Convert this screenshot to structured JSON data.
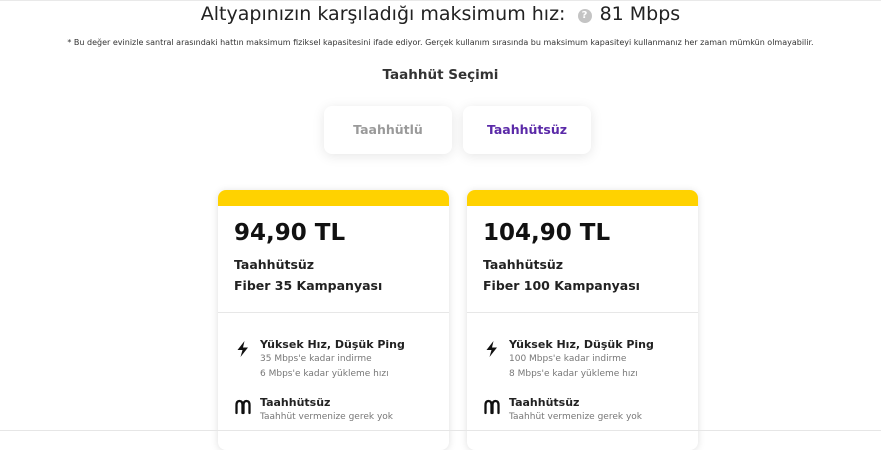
{
  "header": {
    "speed_label": "Altyapınızın karşıladığı maksimum hız:",
    "speed_value": "81 Mbps",
    "help_icon": "question-circle-icon"
  },
  "note": "* Bu değer evinizle santral arasındaki hattın maksimum fiziksel kapasitesini ifade ediyor. Gerçek kullanım sırasında bu maksimum kapasiteyi kullanmanız her zaman mümkün olmayabilir.",
  "commitment": {
    "title": "Taahhüt Seçimi",
    "options": [
      {
        "label": "Taahhütlü",
        "selected": false
      },
      {
        "label": "Taahhütsüz",
        "selected": true
      }
    ],
    "selected_color": "#5b2aa8"
  },
  "accent_color": "#ffd200",
  "plans": [
    {
      "price": "94,90 TL",
      "type": "Taahhütsüz",
      "name": "Fiber 35 Kampanyası",
      "features": [
        {
          "icon": "lightning-bolt-icon",
          "title": "Yüksek Hız, Düşük Ping",
          "lines": [
            "35 Mbps'e kadar indirme",
            "6 Mbps'e kadar yükleme hızı"
          ]
        },
        {
          "icon": "chain-link-icon",
          "title": "Taahhütsüz",
          "lines": [
            "Taahhüt vermenize gerek yok"
          ]
        }
      ]
    },
    {
      "price": "104,90 TL",
      "type": "Taahhütsüz",
      "name": "Fiber 100 Kampanyası",
      "features": [
        {
          "icon": "lightning-bolt-icon",
          "title": "Yüksek Hız, Düşük Ping",
          "lines": [
            "100 Mbps'e kadar indirme",
            "8 Mbps'e kadar yükleme hızı"
          ]
        },
        {
          "icon": "chain-link-icon",
          "title": "Taahhütsüz",
          "lines": [
            "Taahhüt vermenize gerek yok"
          ]
        }
      ]
    }
  ]
}
